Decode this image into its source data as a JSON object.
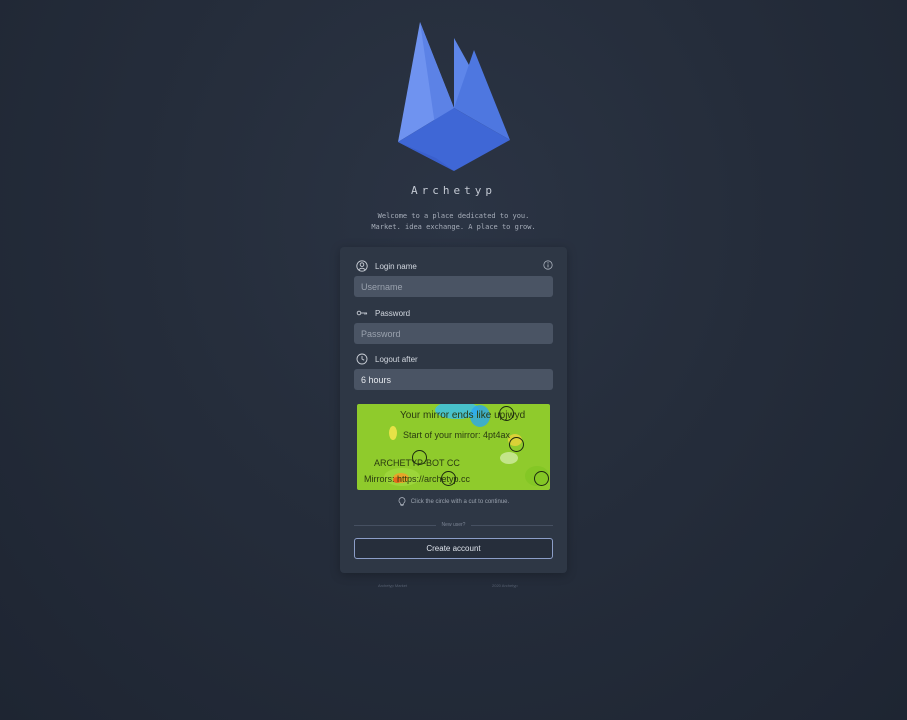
{
  "brand": {
    "name": "Archetyp",
    "tagline_line1": "Welcome to a place dedicated to you.",
    "tagline_line2": "Market. idea exchange. A place to grow."
  },
  "form": {
    "login": {
      "label": "Login name",
      "placeholder": "Username",
      "value": ""
    },
    "password": {
      "label": "Password",
      "placeholder": "Password",
      "value": ""
    },
    "logout": {
      "label": "Logout after",
      "selected": "6 hours"
    }
  },
  "captcha": {
    "line1": "Your mirror ends like upjwyd",
    "line2": "Start of your mirror: 4pt4ax",
    "line3": "ARCHETYP-BOT CC",
    "line4": "Mirrors: https://archetyp.cc",
    "hint": "Click the circle with a cut to continue.",
    "bg_color": "#8fcb2c"
  },
  "signup": {
    "divider_text": "New user?",
    "button_label": "Create account"
  },
  "footer": {
    "left": "Archetyp Market",
    "right": "2020 Archetyp"
  },
  "icons": {
    "login": "user-circle-icon",
    "info": "info-icon",
    "password": "key-icon",
    "logout": "clock-icon",
    "hint": "lightbulb-icon"
  },
  "colors": {
    "background": "#252d3b",
    "card": "#2e3745",
    "input": "#4a5464",
    "logo_primary": "#4a78de",
    "button_border": "#8c9ec8"
  }
}
